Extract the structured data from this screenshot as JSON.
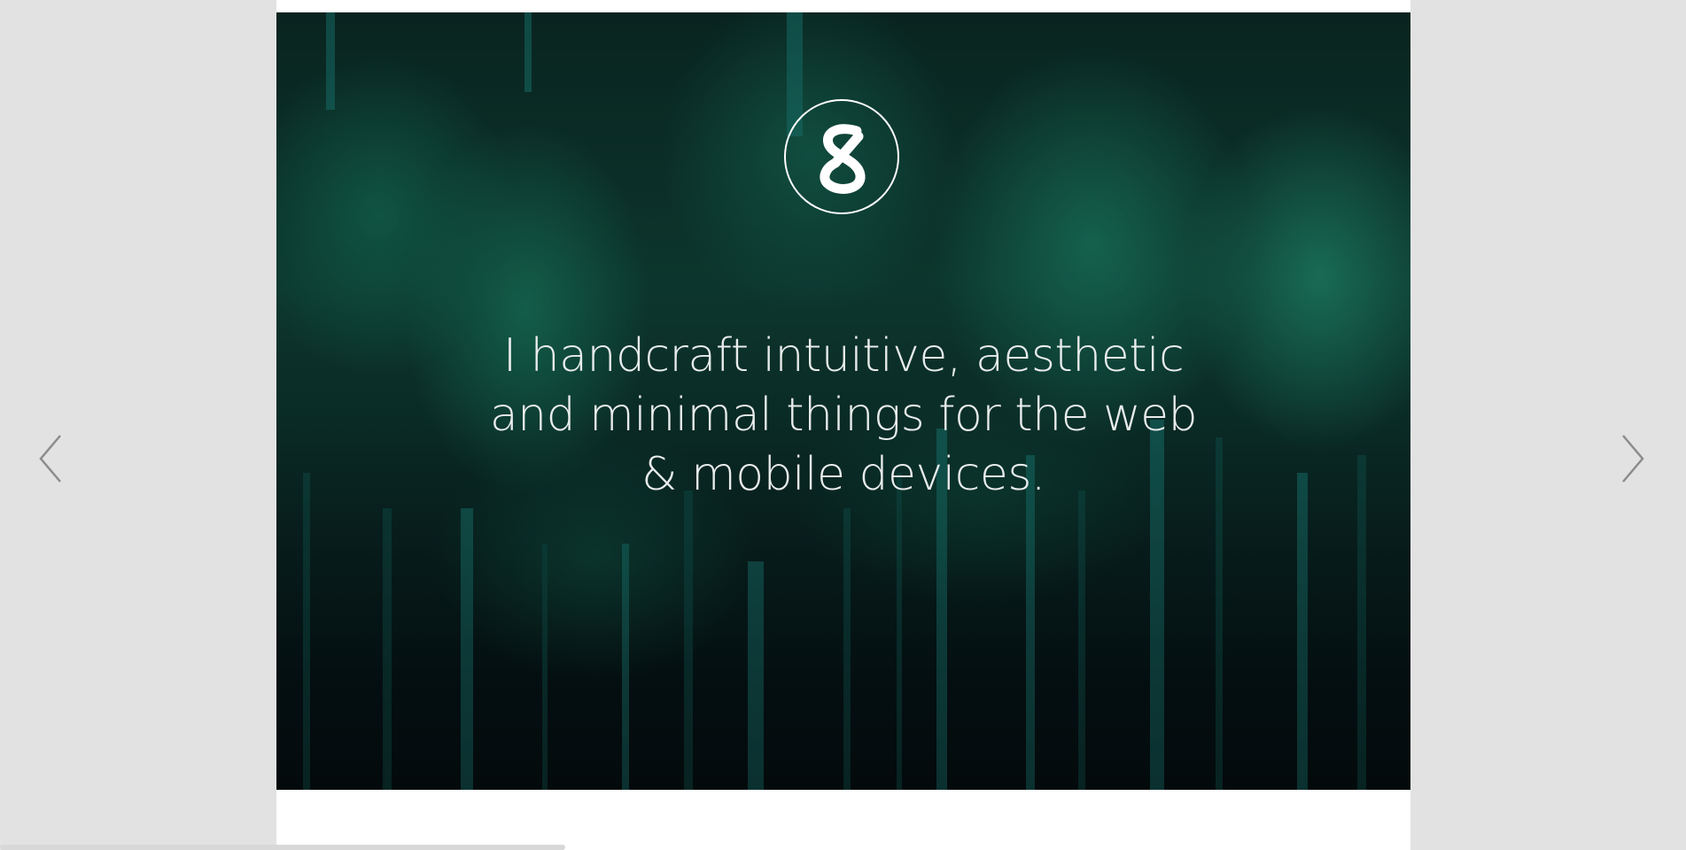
{
  "hero": {
    "logo_icon": "s-monogram-logo-icon",
    "tagline_lines": [
      "I handcraft intuitive, aesthetic",
      "and minimal things for the web",
      "& mobile devices."
    ]
  },
  "navigation": {
    "prev_icon": "chevron-left-icon",
    "next_icon": "chevron-right-icon"
  },
  "colors": {
    "page_background": "#e2e2e2",
    "content_background": "#ffffff",
    "hero_tint": "#0e3d33",
    "text": "#e9ecec",
    "arrow": "#8c8c8c"
  }
}
